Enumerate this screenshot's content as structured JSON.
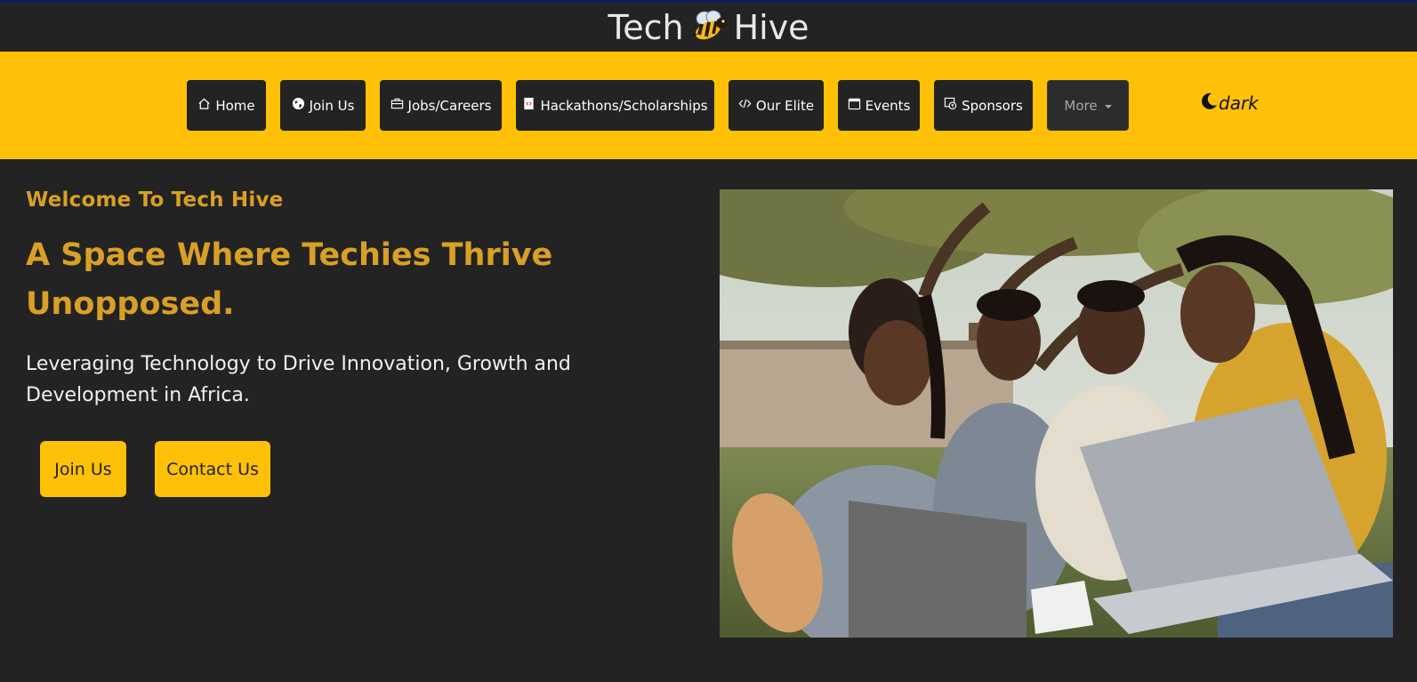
{
  "brand": {
    "name_left": "Tech",
    "name_right": "Hive",
    "icon": "bee-icon"
  },
  "nav": {
    "items": [
      {
        "label": "Home",
        "icon": "home-icon"
      },
      {
        "label": "Join Us",
        "icon": "globe-icon"
      },
      {
        "label": "Jobs/Careers",
        "icon": "briefcase-icon"
      },
      {
        "label": "Hackathons/Scholarships",
        "icon": "code-file-icon"
      },
      {
        "label": "Our Elite",
        "icon": "code-icon"
      },
      {
        "label": "Events",
        "icon": "calendar-icon"
      },
      {
        "label": "Sponsors",
        "icon": "sponsors-icon"
      }
    ],
    "more_label": "More",
    "theme_label": "dark"
  },
  "hero": {
    "welcome": "Welcome To Tech Hive",
    "headline": "A Space Where Techies Thrive Unopposed.",
    "tagline": "Leveraging Technology to Drive Innovation, Growth and Development in Africa.",
    "join_label": "Join Us",
    "contact_label": "Contact Us"
  },
  "colors": {
    "accent": "#ffc107",
    "background": "#232323",
    "headline": "#d9a026",
    "topline": "#0d1a5c"
  }
}
